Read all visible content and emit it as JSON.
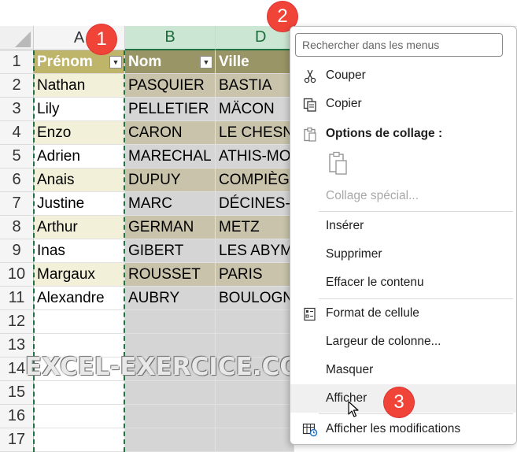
{
  "columns": [
    {
      "letter": "A",
      "selected": false
    },
    {
      "letter": "B",
      "selected": true
    },
    {
      "letter": "D",
      "selected": true
    }
  ],
  "row_numbers": [
    "1",
    "2",
    "3",
    "4",
    "5",
    "6",
    "7",
    "8",
    "9",
    "10",
    "11",
    "12",
    "13",
    "14",
    "15",
    "16",
    "17"
  ],
  "table": {
    "headers": [
      "Prénom",
      "Nom",
      "Ville"
    ],
    "rows": [
      [
        "Nathan",
        "PASQUIER",
        "BASTIA"
      ],
      [
        "Lily",
        "PELLETIER",
        "MÄCON"
      ],
      [
        "Enzo",
        "CARON",
        "LE CHESNAY"
      ],
      [
        "Adrien",
        "MARECHAL",
        "ATHIS-MONS"
      ],
      [
        "Anais",
        "DUPUY",
        "COMPIÈGNE"
      ],
      [
        "Justine",
        "MARC",
        "DÉCINES-CHARPIEU"
      ],
      [
        "Arthur",
        "GERMAN",
        "METZ"
      ],
      [
        "Inas",
        "GIBERT",
        "LES ABYMES"
      ],
      [
        "Margaux",
        "ROUSSET",
        "PARIS"
      ],
      [
        "Alexandre",
        "AUBRY",
        "BOULOGNE"
      ]
    ]
  },
  "badges": {
    "one": "1",
    "two": "2",
    "three": "3"
  },
  "watermark": "EXCEL-EXERCICE.COM",
  "menu": {
    "search_placeholder": "Rechercher dans les menus",
    "items": {
      "cut": "Couper",
      "copy": "Copier",
      "paste_options": "Options de collage :",
      "paste_special": "Collage spécial...",
      "insert": "Insérer",
      "delete": "Supprimer",
      "clear": "Effacer le contenu",
      "format_cells": "Format de cellule",
      "column_width": "Largeur de colonne...",
      "hide": "Masquer",
      "unhide": "Afficher",
      "show_changes": "Afficher les modifications"
    }
  },
  "colors": {
    "accent": "#217346",
    "header_gold": "#bfb56a",
    "badge": "#f04438"
  },
  "icons": {
    "cut": "scissors-icon",
    "copy": "copy-icon",
    "paste": "clipboard-icon",
    "format": "format-cells-icon",
    "changes": "show-changes-icon"
  }
}
